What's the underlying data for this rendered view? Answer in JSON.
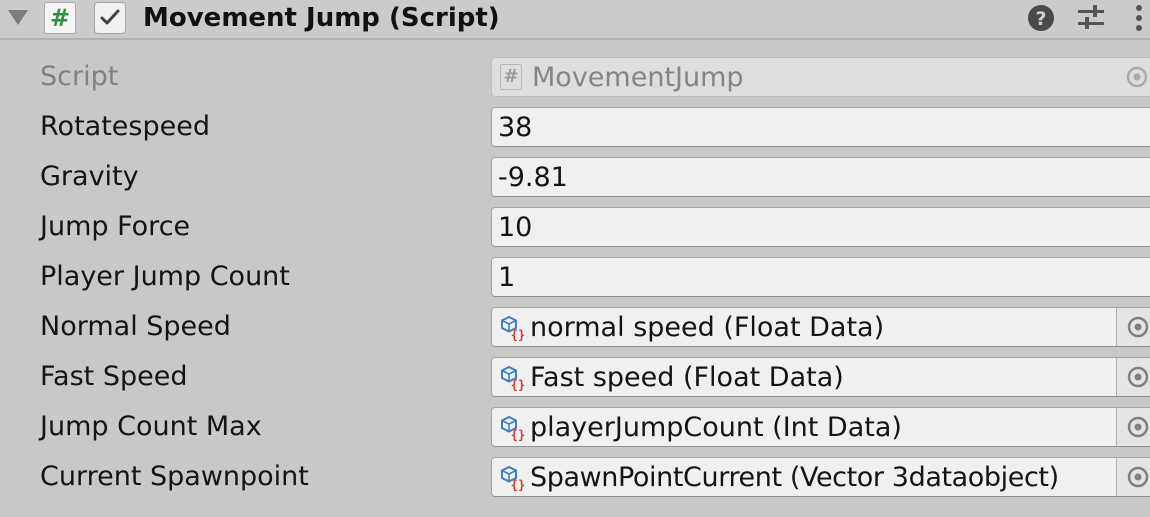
{
  "component": {
    "title": "Movement Jump (Script)",
    "script_badge": "#",
    "enabled": true
  },
  "header_icons": [
    "help-icon",
    "preset-sliders-icon",
    "context-menu-icon"
  ],
  "properties": [
    {
      "label": "Script",
      "value": "MovementJump",
      "type": "script-reference",
      "disabled": true
    },
    {
      "label": "Rotatespeed",
      "value": "38",
      "type": "number"
    },
    {
      "label": "Gravity",
      "value": "-9.81",
      "type": "number"
    },
    {
      "label": "Jump Force",
      "value": "10",
      "type": "number"
    },
    {
      "label": "Player Jump Count",
      "value": "1",
      "type": "number"
    },
    {
      "label": "Normal Speed",
      "value": "normal speed (Float Data)",
      "type": "object-reference"
    },
    {
      "label": "Fast Speed",
      "value": "Fast speed (Float Data)",
      "type": "object-reference"
    },
    {
      "label": "Jump Count Max",
      "value": "playerJumpCount (Int Data)",
      "type": "object-reference"
    },
    {
      "label": "Current Spawnpoint",
      "value": "SpawnPointCurrent (Vector 3dataobject)",
      "type": "object-reference"
    }
  ],
  "colors": {
    "panel_background": "#c8c8c8",
    "field_background": "#f0f0f0",
    "script_badge_green": "#2f8f3a",
    "scriptable_object_icon_blue": "#3d7fc4",
    "scriptable_object_icon_red": "#d23a2a"
  }
}
